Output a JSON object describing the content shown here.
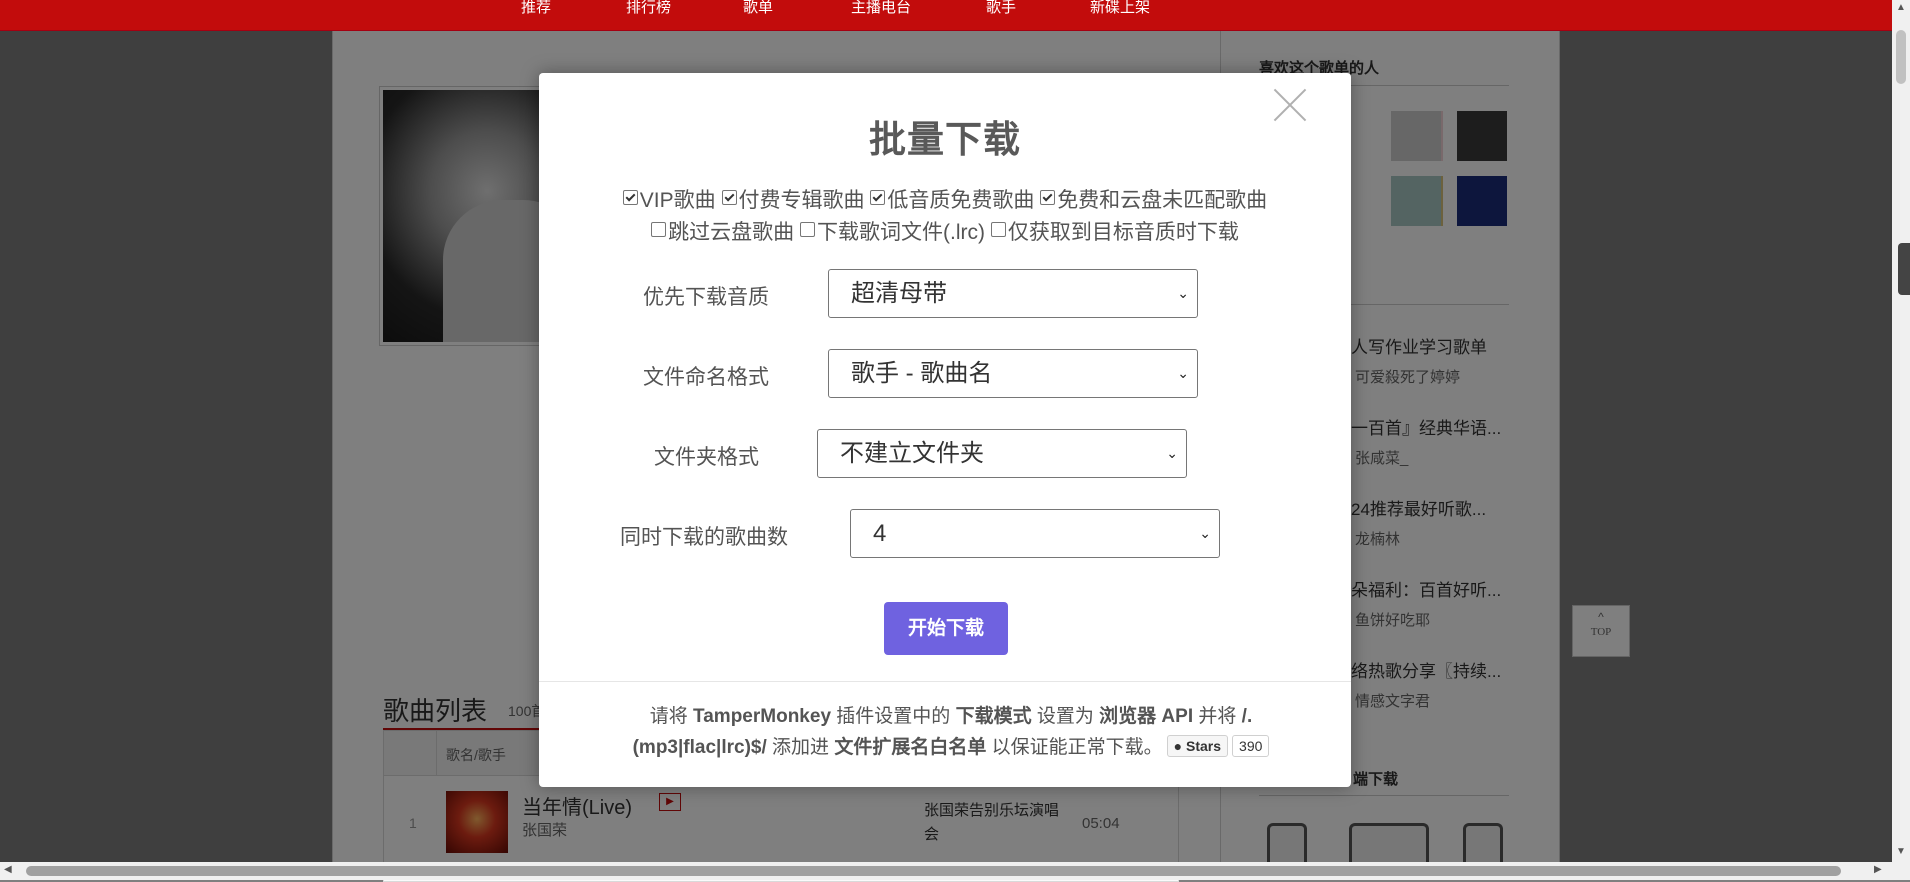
{
  "nav": {
    "items": [
      {
        "label": "推荐"
      },
      {
        "label": "排行榜"
      },
      {
        "label": "歌单"
      },
      {
        "label": "主播电台"
      },
      {
        "label": "歌手"
      },
      {
        "label": "新碟上架"
      }
    ]
  },
  "page": {
    "songlist_title": "歌曲列表",
    "songlist_count": "100首",
    "col_song": "歌名/歌手",
    "row": {
      "index": "1",
      "title": "当年情(Live)",
      "artist": "张国荣",
      "album": "张国荣告别乐坛演唱会",
      "duration": "05:04"
    }
  },
  "sidebar": {
    "likers_heading": "喜欢这个歌单的人",
    "playlists": [
      {
        "title": "人写作业学习歌单",
        "by": "可爱殺死了婷婷"
      },
      {
        "title": "一百首』经典华语...",
        "by": "张咸菜_"
      },
      {
        "title": "24推荐最好听歌...",
        "by": "龙楠林"
      },
      {
        "title": "朵福利：百首好听...",
        "by": "鱼饼好吃耶"
      },
      {
        "title": "络热歌分享〖持续...",
        "by": "情感文字君"
      }
    ],
    "client_heading": "端下载"
  },
  "top_button": {
    "arrow": "^",
    "label": "TOP"
  },
  "modal": {
    "title": "批量下载",
    "checkboxes": [
      {
        "label": "VIP歌曲",
        "checked": true
      },
      {
        "label": "付费专辑歌曲",
        "checked": true
      },
      {
        "label": "低音质免费歌曲",
        "checked": true
      },
      {
        "label": "免费和云盘未匹配歌曲",
        "checked": true
      },
      {
        "label": "跳过云盘歌曲",
        "checked": false
      },
      {
        "label": "下载歌词文件(.lrc)",
        "checked": false
      },
      {
        "label": "仅获取到目标音质时下载",
        "checked": false
      }
    ],
    "fields": [
      {
        "label": "优先下载音质",
        "value": "超清母带"
      },
      {
        "label": "文件命名格式",
        "value": "歌手 - 歌曲名"
      },
      {
        "label": "文件夹格式",
        "value": "不建立文件夹"
      },
      {
        "label": "同时下载的歌曲数",
        "value": "4"
      }
    ],
    "start_button": "开始下载",
    "footer": {
      "p1": "请将 ",
      "b1": "TamperMonkey",
      "p2": " 插件设置中的 ",
      "b2": "下载模式",
      "p3": " 设置为 ",
      "b3": "浏览器 API",
      "p4": " 并将 ",
      "b4": "/.(mp3|flac|lrc)$/",
      "p5": " 添加进 ",
      "b5": "文件扩展名白名单",
      "p6": " 以保证能正常下载。",
      "stars_label": "Stars",
      "stars_count": "390"
    }
  },
  "colors": {
    "nav_red": "#c20c0c",
    "button_purple": "#6f62e0"
  }
}
